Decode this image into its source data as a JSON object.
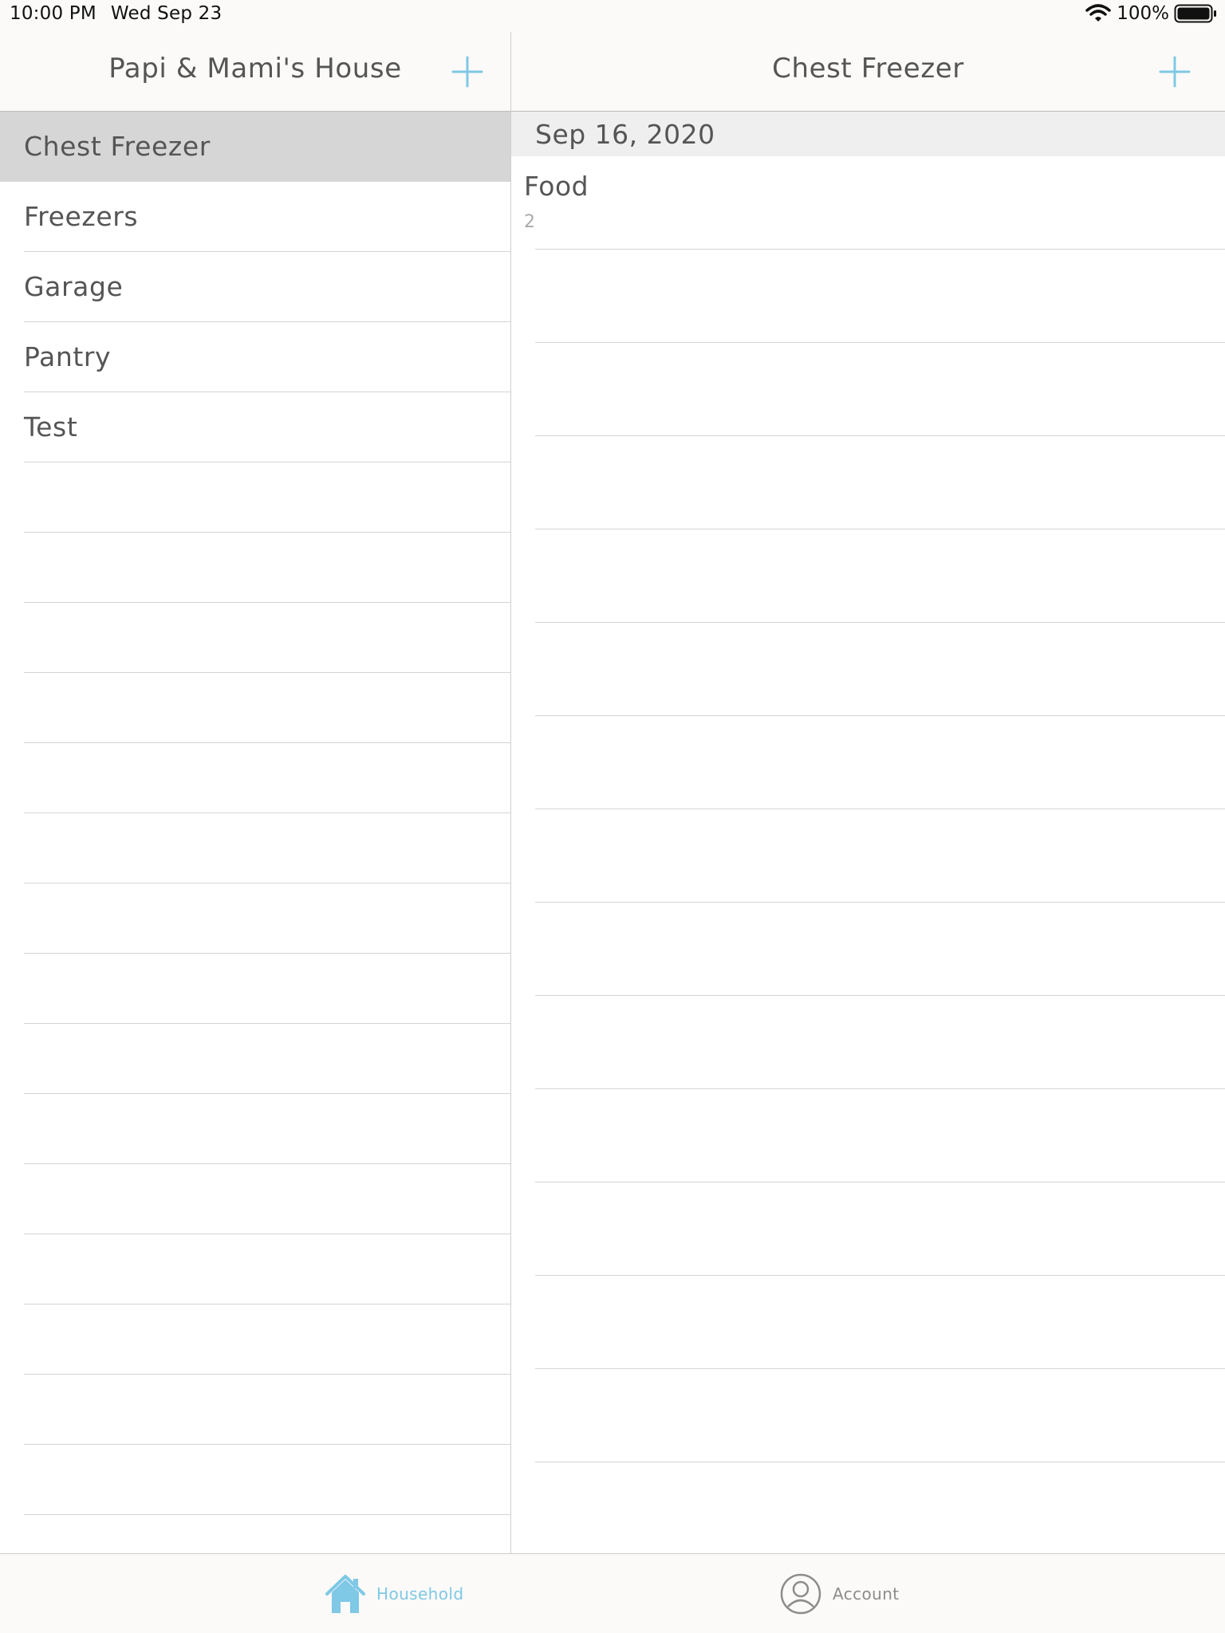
{
  "status_bar": {
    "time": "10:00 PM",
    "date": "Wed Sep 23",
    "battery": "100%"
  },
  "left_pane": {
    "title": "Papi & Mami's House",
    "items": [
      "Chest Freezer",
      "Freezers",
      "Garage",
      "Pantry",
      "Test"
    ],
    "selected_index": 0
  },
  "right_pane": {
    "title": "Chest Freezer",
    "section_header": "Sep 16, 2020",
    "rows": [
      {
        "name": "Food",
        "count": "2"
      }
    ]
  },
  "tab_bar": {
    "household_label": "Household",
    "account_label": "Account"
  },
  "colors": {
    "accent": "#7fc8e6",
    "selected_row": "#d6d6d6",
    "bar_background": "#fbfaf8"
  }
}
